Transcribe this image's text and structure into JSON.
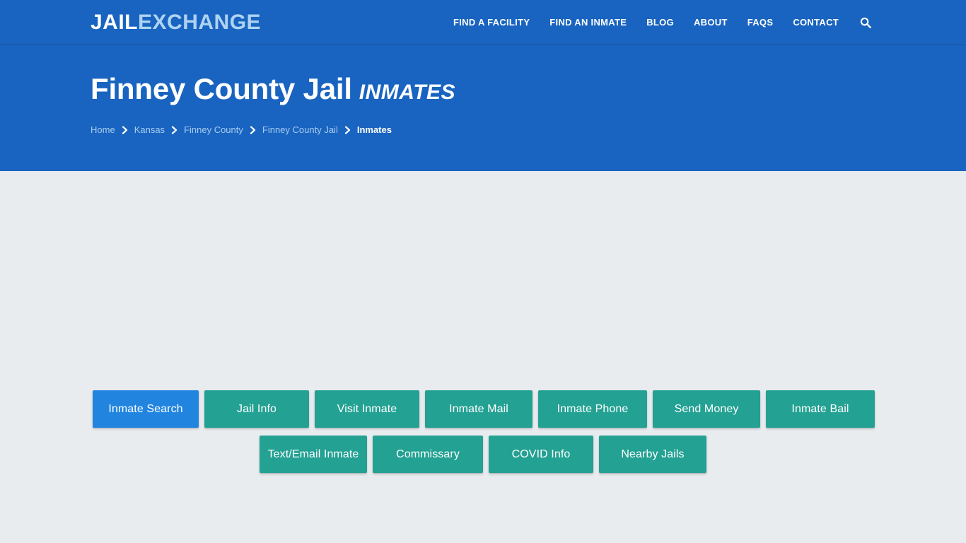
{
  "site": {
    "logo_primary": "JAIL",
    "logo_secondary": "EXCHANGE"
  },
  "nav": {
    "items": [
      {
        "label": "FIND A FACILITY",
        "name": "nav-find-a-facility"
      },
      {
        "label": "FIND AN INMATE",
        "name": "nav-find-an-inmate"
      },
      {
        "label": "BLOG",
        "name": "nav-blog"
      },
      {
        "label": "ABOUT",
        "name": "nav-about"
      },
      {
        "label": "FAQs",
        "name": "nav-faqs"
      },
      {
        "label": "CONTACT",
        "name": "nav-contact"
      }
    ],
    "search_icon": "search-icon"
  },
  "hero": {
    "title": "Finney County Jail",
    "title_suffix": "INMATES",
    "breadcrumb": [
      {
        "label": "Home",
        "current": false
      },
      {
        "label": "Kansas",
        "current": false
      },
      {
        "label": "Finney County",
        "current": false
      },
      {
        "label": "Finney County Jail",
        "current": false
      },
      {
        "label": "Inmates",
        "current": true
      }
    ],
    "separator_icon": "chevron-right-icon"
  },
  "tabs": {
    "row1": [
      {
        "label": "Inmate Search",
        "active": true
      },
      {
        "label": "Jail Info",
        "active": false
      },
      {
        "label": "Visit Inmate",
        "active": false
      },
      {
        "label": "Inmate Mail",
        "active": false
      },
      {
        "label": "Inmate Phone",
        "active": false
      },
      {
        "label": "Send Money",
        "active": false
      },
      {
        "label": "Inmate Bail",
        "active": false
      }
    ],
    "row2": [
      {
        "label": "Text/Email Inmate",
        "active": false
      },
      {
        "label": "Commissary",
        "active": false
      },
      {
        "label": "COVID Info",
        "active": false
      },
      {
        "label": "Nearby Jails",
        "active": false
      }
    ]
  },
  "colors": {
    "brand_blue": "#1964c0",
    "active_blue": "#2185e0",
    "teal": "#23a193",
    "body_bg": "#e9ecef",
    "logo_secondary": "#aed3f2",
    "breadcrumb_link": "#a7ccef"
  }
}
